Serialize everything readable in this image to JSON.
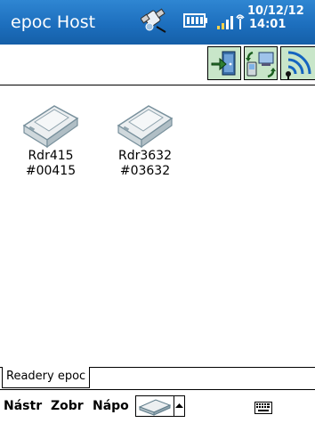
{
  "titlebar": {
    "app_title": "epoc Host",
    "clock_date": "10/12/12",
    "clock_time": "14:01"
  },
  "toolbar": {
    "buttons": [
      {
        "icon": "exit-door-icon"
      },
      {
        "icon": "sync-devices-icon"
      },
      {
        "icon": "wireless-signal-icon"
      }
    ]
  },
  "readers": [
    {
      "name": "Rdr415",
      "serial": "#00415",
      "icon": "reader-device-icon"
    },
    {
      "name": "Rdr3632",
      "serial": "#03632",
      "icon": "reader-device-icon"
    }
  ],
  "tabs": [
    {
      "label": "Readery epoc",
      "selected": true
    }
  ],
  "menubar": {
    "items": [
      "Nástr",
      "Zobr",
      "Nápo"
    ],
    "icons": [
      "reader-menu-icon",
      "arrow-up-icon",
      "keyboard-icon"
    ]
  },
  "colors": {
    "titlebar": "#1d6fbe",
    "toolbar_button_bg": "#c8e6c9"
  }
}
